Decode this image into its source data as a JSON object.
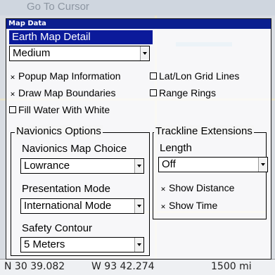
{
  "background": {
    "ghost_title": "Go To Cursor",
    "status": {
      "lat": "N   30 39.082",
      "lon": "W   93 42.274",
      "scale": "1500 mi"
    }
  },
  "dialog": {
    "title": "Map Data",
    "earth_map_detail": {
      "label": "Earth Map Detail",
      "value": "Medium"
    },
    "checkboxes": [
      {
        "label": "Popup Map Information",
        "checked": true
      },
      {
        "label": "Lat/Lon Grid Lines",
        "checked": false
      },
      {
        "label": "Draw Map Boundaries",
        "checked": true
      },
      {
        "label": "Range Rings",
        "checked": false
      },
      {
        "label": "Fill Water With White",
        "checked": false
      }
    ],
    "navionics": {
      "title": "Navionics Options",
      "map_choice": {
        "label": "Navionics Map Choice",
        "value": "Lowrance"
      },
      "presentation": {
        "label": "Presentation Mode",
        "value": "International Mode"
      },
      "safety": {
        "label": "Safety Contour",
        "value": "5 Meters"
      }
    },
    "trackline": {
      "title": "Trackline Extensions",
      "length": {
        "label": "Length",
        "value": "Off"
      },
      "show_distance": {
        "label": "Show Distance",
        "checked": true
      },
      "show_time": {
        "label": "Show Time",
        "checked": true
      }
    }
  },
  "icons": {
    "checked_glyph": "✕",
    "unchecked_glyph": ""
  }
}
